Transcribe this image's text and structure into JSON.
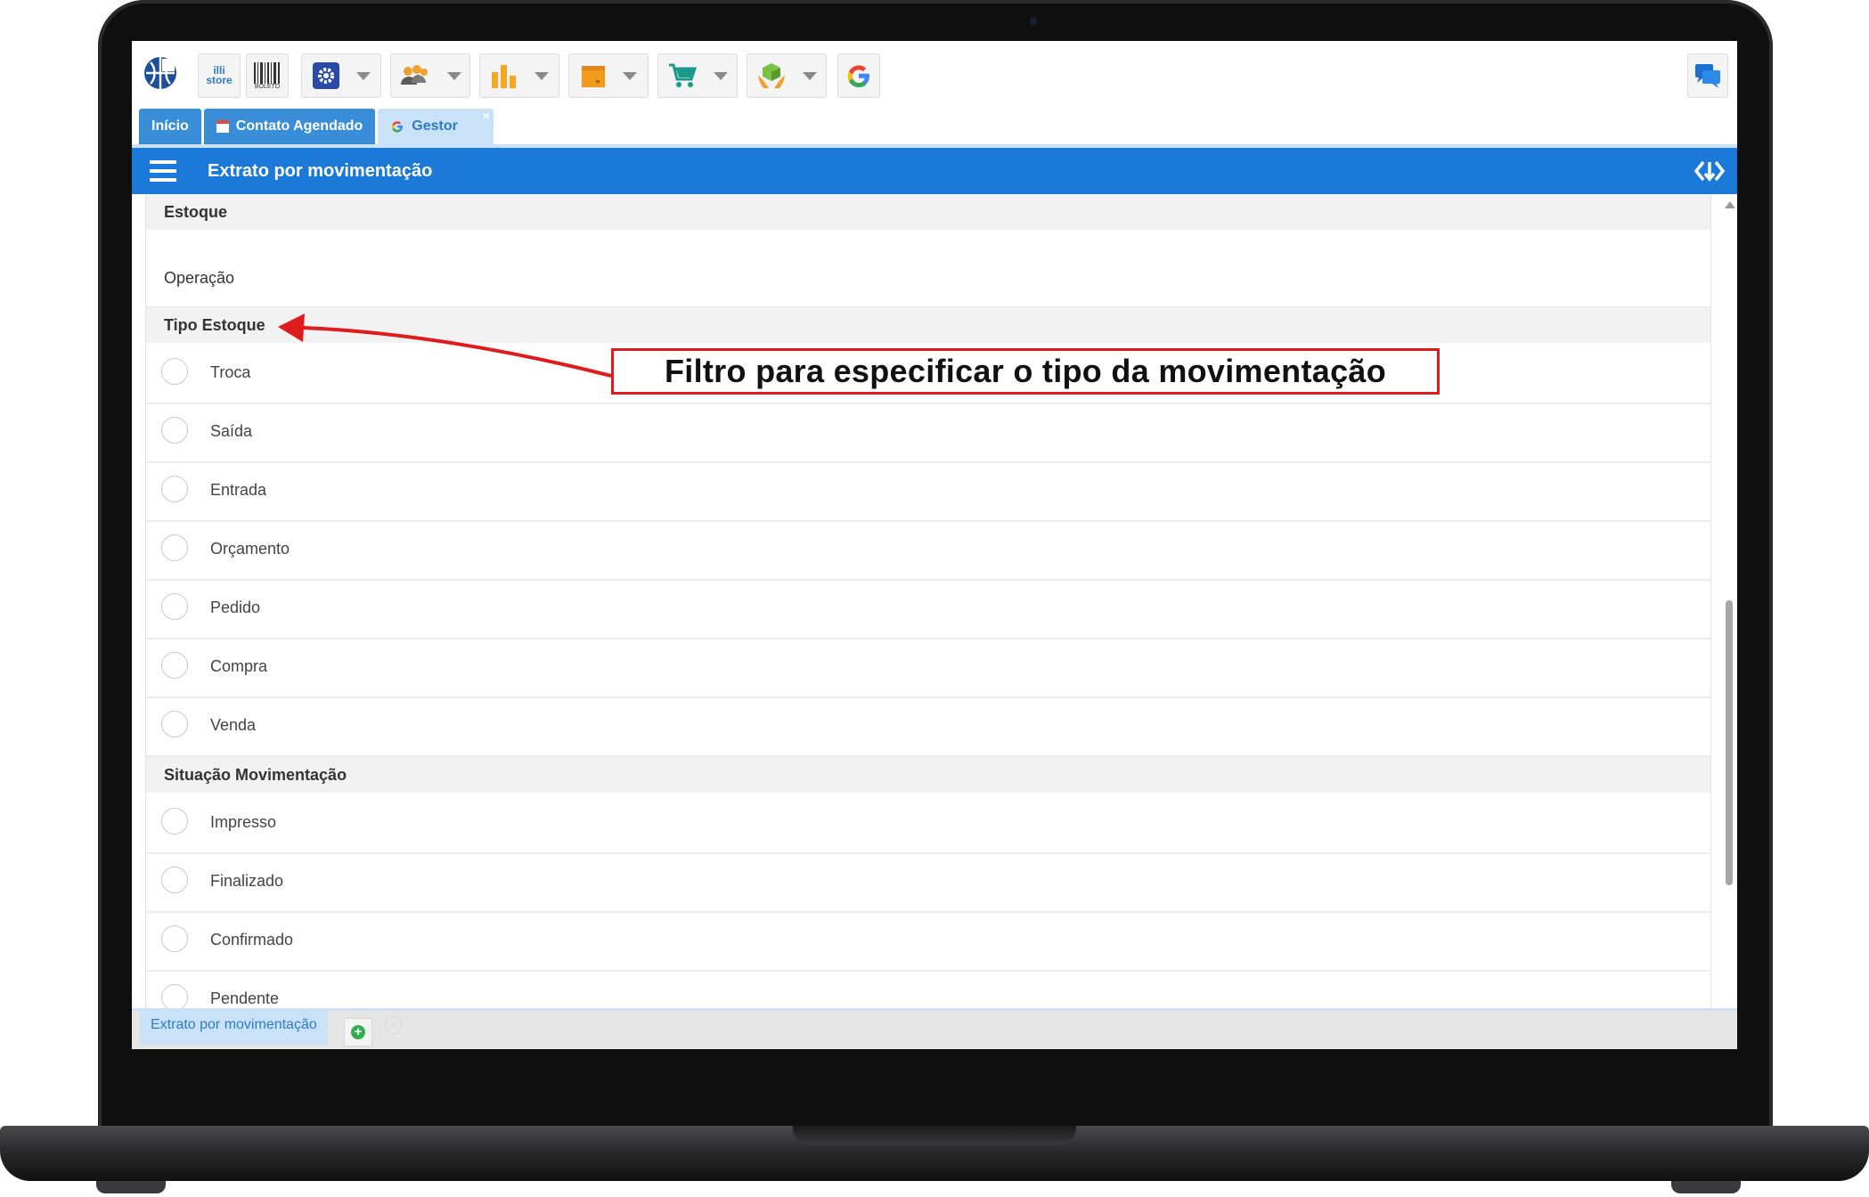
{
  "toolbar": {
    "store_logo_text": "illi\nstore",
    "boleto_text": "BOLETO",
    "icons": [
      "globe-logo-icon",
      "illi-store-icon",
      "barcode-icon",
      "settings-icon",
      "users-icon",
      "bar-chart-icon",
      "box-icon",
      "cart-icon",
      "hands-cube-icon",
      "google-icon",
      "chat-icon"
    ]
  },
  "tabs": [
    {
      "label": "Início"
    },
    {
      "label": "Contato Agendado"
    },
    {
      "label": "Gestor",
      "close": "×"
    }
  ],
  "header": {
    "title": "Extrato por movimentação"
  },
  "sections": {
    "estoque": {
      "title": "Estoque",
      "operacao_label": "Operação"
    },
    "tipo_estoque": {
      "title": "Tipo Estoque",
      "options": [
        "Troca",
        "Saída",
        "Entrada",
        "Orçamento",
        "Pedido",
        "Compra",
        "Venda"
      ]
    },
    "situacao": {
      "title": "Situação Movimentação",
      "options": [
        "Impresso",
        "Finalizado",
        "Confirmado",
        "Pendente"
      ]
    }
  },
  "bottom_bar": {
    "tab_label": "Extrato por movimentação",
    "add_symbol": "+",
    "close_symbol": "×"
  },
  "annotation": {
    "text": "Filtro para especificar o tipo da movimentação",
    "color": "#e01b1b"
  },
  "colors": {
    "header_blue": "#1b79d8",
    "tab_blue": "#3a8ed8",
    "tab_active": "#c9e2f7"
  }
}
